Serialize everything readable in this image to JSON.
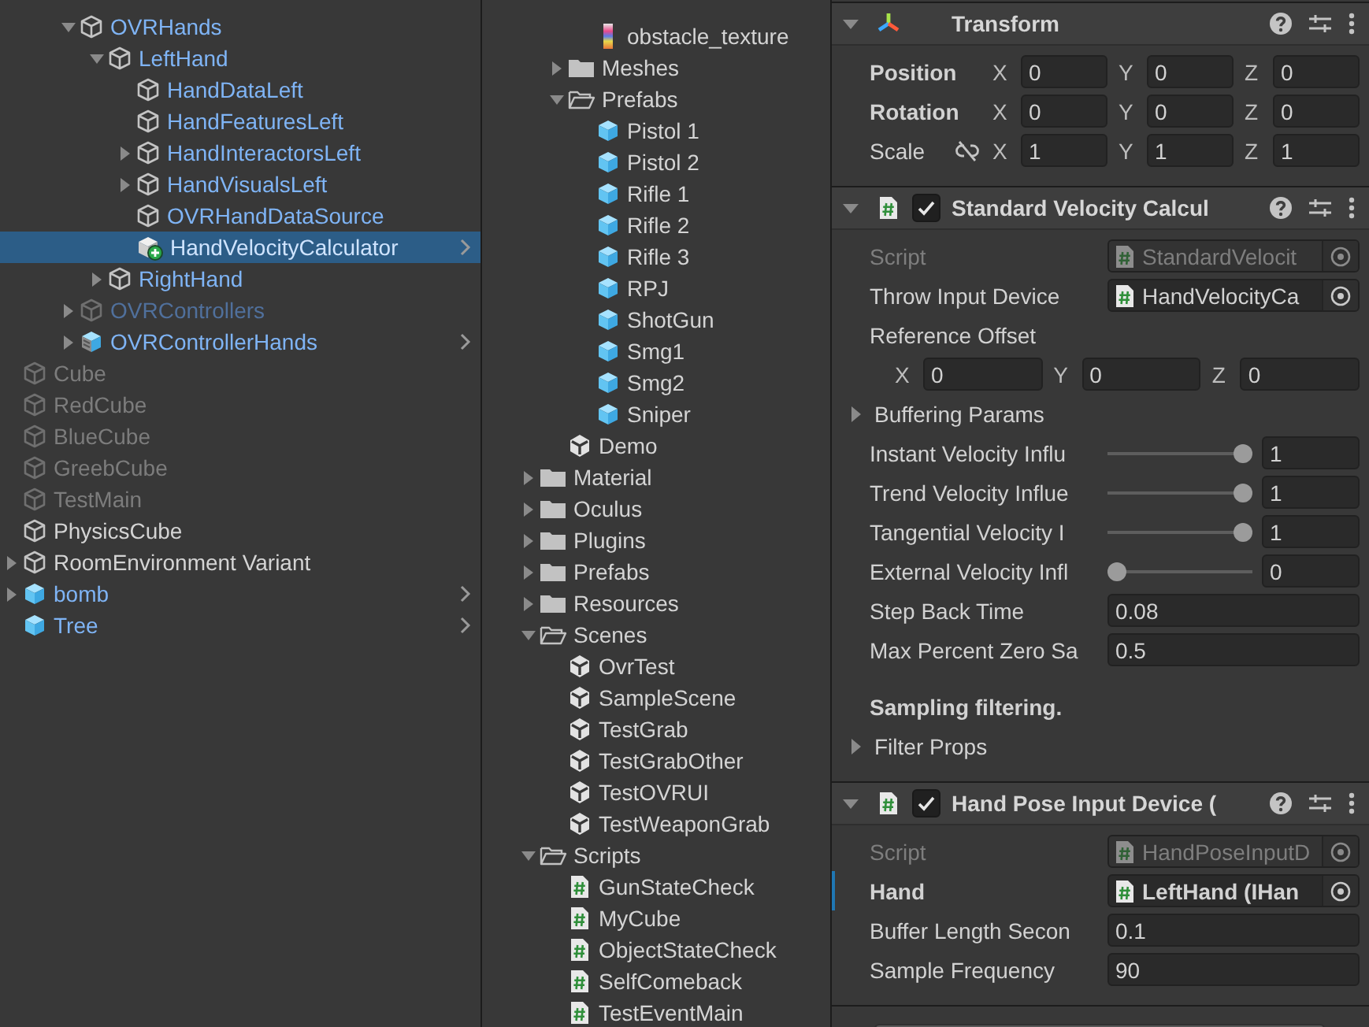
{
  "hierarchy": {
    "items": [
      {
        "children": [
          {
            "children": [
              {
                "name": "OVRHands",
                "kind": "prefab_part",
                "expanded": true,
                "selected": false,
                "children": [
                  {
                    "name": "LeftHand",
                    "kind": "prefab_part",
                    "expanded": true,
                    "selected": false,
                    "children": [
                      {
                        "name": "HandDataLeft",
                        "kind": "prefab_part",
                        "selected": false
                      },
                      {
                        "name": "HandFeaturesLeft",
                        "kind": "prefab_part",
                        "selected": false
                      },
                      {
                        "name": "HandInteractorsLeft",
                        "kind": "prefab_part",
                        "expanded": false,
                        "selected": false
                      },
                      {
                        "name": "HandVisualsLeft",
                        "kind": "prefab_part",
                        "expanded": false,
                        "selected": false
                      },
                      {
                        "name": "OVRHandDataSource",
                        "kind": "prefab_part",
                        "selected": false
                      },
                      {
                        "name": "HandVelocityCalculator",
                        "kind": "added",
                        "selected": true,
                        "open_arrow": true
                      }
                    ]
                  },
                  {
                    "name": "RightHand",
                    "kind": "prefab_part",
                    "expanded": false,
                    "selected": false
                  }
                ]
              },
              {
                "name": "OVRControllers",
                "kind": "inactive_part",
                "expanded": false,
                "selected": false
              },
              {
                "name": "OVRControllerHands",
                "kind": "variant",
                "expanded": false,
                "selected": false,
                "open_arrow": true
              }
            ]
          }
        ]
      },
      {
        "name": "Cube",
        "kind": "inactive",
        "selected": false
      },
      {
        "name": "RedCube",
        "kind": "inactive",
        "selected": false
      },
      {
        "name": "BlueCube",
        "kind": "inactive",
        "selected": false
      },
      {
        "name": "GreebCube",
        "kind": "inactive",
        "selected": false
      },
      {
        "name": "TestMain",
        "kind": "inactive",
        "selected": false
      },
      {
        "name": "PhysicsCube",
        "kind": "object",
        "selected": false
      },
      {
        "name": "RoomEnvironment Variant",
        "kind": "object",
        "expanded": false,
        "selected": false
      },
      {
        "name": "bomb",
        "kind": "prefab",
        "expanded": false,
        "selected": false,
        "open_arrow": true
      },
      {
        "name": "Tree",
        "kind": "prefab",
        "selected": false,
        "open_arrow": true
      }
    ]
  },
  "project": {
    "items": [
      {
        "children": [
          {
            "children": [
              {
                "name": "obstacle_texture",
                "kind": "texture",
                "selected": false
              }
            ]
          },
          {
            "name": "Meshes",
            "kind": "folder",
            "expanded": false,
            "selected": false
          },
          {
            "name": "Prefabs",
            "kind": "folder",
            "expanded": true,
            "selected": false,
            "children": [
              {
                "name": "Pistol 1",
                "kind": "prefab_asset",
                "selected": false
              },
              {
                "name": "Pistol 2",
                "kind": "prefab_asset",
                "selected": false
              },
              {
                "name": "Rifle 1",
                "kind": "prefab_asset",
                "selected": false
              },
              {
                "name": "Rifle 2",
                "kind": "prefab_asset",
                "selected": false
              },
              {
                "name": "Rifle 3",
                "kind": "prefab_asset",
                "selected": false
              },
              {
                "name": "RPJ",
                "kind": "prefab_asset",
                "selected": false
              },
              {
                "name": "ShotGun",
                "kind": "prefab_asset",
                "selected": false
              },
              {
                "name": "Smg1",
                "kind": "prefab_asset",
                "selected": false
              },
              {
                "name": "Smg2",
                "kind": "prefab_asset",
                "selected": false
              },
              {
                "name": "Sniper",
                "kind": "prefab_asset",
                "selected": false
              }
            ]
          },
          {
            "name": "Demo",
            "kind": "scene",
            "selected": false
          }
        ]
      },
      {
        "name": "Material",
        "kind": "folder",
        "expanded": false,
        "selected": false
      },
      {
        "name": "Oculus",
        "kind": "folder",
        "expanded": false,
        "selected": false
      },
      {
        "name": "Plugins",
        "kind": "folder",
        "expanded": false,
        "selected": false
      },
      {
        "name": "Prefabs",
        "kind": "folder",
        "expanded": false,
        "selected": false
      },
      {
        "name": "Resources",
        "kind": "folder",
        "expanded": false,
        "selected": false
      },
      {
        "name": "Scenes",
        "kind": "folder",
        "expanded": true,
        "selected": false,
        "children": [
          {
            "name": "OvrTest",
            "kind": "scene",
            "selected": false
          },
          {
            "name": "SampleScene",
            "kind": "scene",
            "selected": false
          },
          {
            "name": "TestGrab",
            "kind": "scene",
            "selected": false
          },
          {
            "name": "TestGrabOther",
            "kind": "scene",
            "selected": false
          },
          {
            "name": "TestOVRUI",
            "kind": "scene",
            "selected": false
          },
          {
            "name": "TestWeaponGrab",
            "kind": "scene",
            "selected": false
          }
        ]
      },
      {
        "name": "Scripts",
        "kind": "folder",
        "expanded": true,
        "selected": false,
        "children": [
          {
            "name": "GunStateCheck",
            "kind": "script",
            "selected": false
          },
          {
            "name": "MyCube",
            "kind": "script",
            "selected": false
          },
          {
            "name": "ObjectStateCheck",
            "kind": "script",
            "selected": false
          },
          {
            "name": "SelfComeback",
            "kind": "script",
            "selected": false
          },
          {
            "name": "TestEventMain",
            "kind": "script",
            "selected": false
          }
        ]
      }
    ]
  },
  "inspector": {
    "components": [
      {
        "title": "Transform",
        "kind": "transform",
        "expanded": true,
        "fields": [
          {
            "kind": "vector3",
            "label": "Position",
            "bold": true,
            "values": [
              {
                "axis": "X",
                "value": "0"
              },
              {
                "axis": "Y",
                "value": "0"
              },
              {
                "axis": "Z",
                "value": "0"
              }
            ]
          },
          {
            "kind": "vector3",
            "label": "Rotation",
            "bold": true,
            "values": [
              {
                "axis": "X",
                "value": "0"
              },
              {
                "axis": "Y",
                "value": "0"
              },
              {
                "axis": "Z",
                "value": "0"
              }
            ]
          },
          {
            "kind": "vector3",
            "label": "Scale",
            "bold": false,
            "ratio_locked": false,
            "values": [
              {
                "axis": "X",
                "value": "1"
              },
              {
                "axis": "Y",
                "value": "1"
              },
              {
                "axis": "Z",
                "value": "1"
              }
            ]
          }
        ]
      },
      {
        "title": "Standard Velocity Calcul",
        "kind": "script",
        "enabled": true,
        "expanded": true,
        "fields": [
          {
            "kind": "object",
            "label": "Script",
            "value": "StandardVelocit",
            "disabled": true,
            "overridden": false
          },
          {
            "kind": "object",
            "label": "Throw Input Device",
            "value": "HandVelocityCa",
            "disabled": false,
            "overridden": false
          },
          {
            "kind": "label",
            "label": "Reference Offset"
          },
          {
            "kind": "vector3_row",
            "values": [
              {
                "axis": "X",
                "value": "0"
              },
              {
                "axis": "Y",
                "value": "0"
              },
              {
                "axis": "Z",
                "value": "0"
              }
            ]
          },
          {
            "kind": "foldout",
            "label": "Buffering Params",
            "expanded": false
          },
          {
            "kind": "slider",
            "label": "Instant Velocity Influ",
            "level": 1,
            "value": "1"
          },
          {
            "kind": "slider",
            "label": "Trend Velocity Influe",
            "level": 1,
            "value": "1"
          },
          {
            "kind": "slider",
            "label": "Tangential Velocity I",
            "level": 1,
            "value": "1"
          },
          {
            "kind": "slider",
            "label": "External Velocity Infl",
            "level": 0,
            "value": "0"
          },
          {
            "kind": "number",
            "label": "Step Back Time",
            "value": "0.08"
          },
          {
            "kind": "number",
            "label": "Max Percent Zero Sa",
            "value": "0.5"
          },
          {
            "kind": "heading",
            "label": "Sampling filtering."
          },
          {
            "kind": "foldout",
            "label": "Filter Props",
            "expanded": false
          }
        ]
      },
      {
        "title": "Hand Pose Input Device (",
        "kind": "script",
        "enabled": true,
        "expanded": true,
        "fields": [
          {
            "kind": "object",
            "label": "Script",
            "value": "HandPoseInputD",
            "disabled": true,
            "overridden": false
          },
          {
            "kind": "object",
            "label": "Hand",
            "value": "LeftHand (IHan",
            "disabled": false,
            "overridden": true
          },
          {
            "kind": "number",
            "label": "Buffer Length Secon",
            "value": "0.1"
          },
          {
            "kind": "number",
            "label": "Sample Frequency",
            "value": "90"
          }
        ]
      }
    ]
  }
}
